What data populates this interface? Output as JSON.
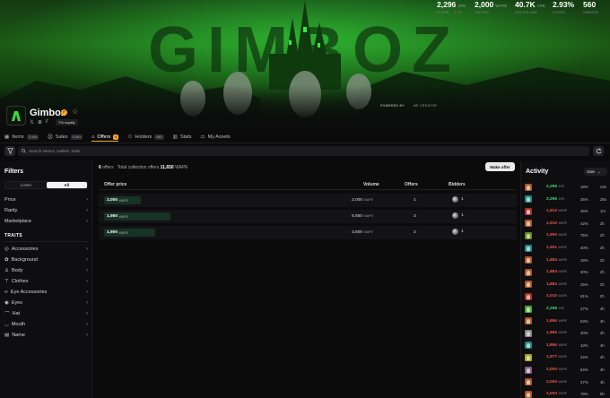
{
  "collection": {
    "name": "Gimboz",
    "royalty": "7% royalty",
    "banner_text": "GIMBOZ",
    "powered_by": "POWERED BY",
    "powered_by_name": "ME CREATOR"
  },
  "stats": [
    {
      "value": "2,296",
      "unit": "APE",
      "label": "FLOOR",
      "change": "-0.1%"
    },
    {
      "value": "2,000",
      "unit": "WAPE",
      "label": "TOP BID",
      "change": ""
    },
    {
      "value": "40.7K",
      "unit": "APE",
      "label": "24H VOLUME",
      "change": ""
    },
    {
      "value": "2.93%",
      "unit": "",
      "label": "LISTED",
      "change": ""
    },
    {
      "value": "560",
      "unit": "",
      "label": "OWNERS",
      "change": ""
    }
  ],
  "tabs": [
    {
      "label": "Items",
      "count": "3,444"
    },
    {
      "label": "Sales",
      "count": "4,491"
    },
    {
      "label": "Offers",
      "count": "6"
    },
    {
      "label": "Holders",
      "count": "560"
    },
    {
      "label": "Stats",
      "count": ""
    },
    {
      "label": "My Assets",
      "count": ""
    }
  ],
  "search": {
    "placeholder": "Search tokens, wallets, traits"
  },
  "filters": {
    "title": "Filters",
    "toggle": [
      "Listed",
      "All"
    ],
    "sections": [
      "Price",
      "Rarity",
      "Marketplace"
    ],
    "traits_title": "TRAITS",
    "traits": [
      "Accessories",
      "Background",
      "Body",
      "Clothes",
      "Eye Accessories",
      "Eyes",
      "Hat",
      "Mouth",
      "Name"
    ]
  },
  "offers": {
    "count": "6",
    "count_label": "offers",
    "total_label": "Total collection offers",
    "total_value": "11,650",
    "total_unit": "WAPE",
    "make_offer": "Make offer",
    "headers": [
      "Offer price",
      "Volume",
      "Offers",
      "Bidders"
    ],
    "rows": [
      {
        "price": "2,000",
        "unit": "WAPE",
        "volume": "2,000",
        "offers": "1",
        "bidders": "1",
        "fill": 0.17
      },
      {
        "price": "1,950",
        "unit": "WAPE",
        "volume": "5,850",
        "offers": "3",
        "bidders": "1",
        "fill": 0.5
      },
      {
        "price": "1,900",
        "unit": "WAPE",
        "volume": "3,800",
        "offers": "2",
        "bidders": "1",
        "fill": 0.33
      }
    ]
  },
  "activity": {
    "title": "Activity",
    "filter": "Sale",
    "rows": [
      {
        "price": "2,296",
        "unit": "APE",
        "pct": "19%",
        "time": "23s",
        "up": true,
        "thumb": "#b4552a"
      },
      {
        "price": "2,296",
        "unit": "APE",
        "pct": "25%",
        "time": "25s",
        "up": true,
        "thumb": "#1e8a8a"
      },
      {
        "price": "1,912",
        "unit": "WAPE",
        "pct": "45%",
        "time": "1m",
        "up": false,
        "thumb": "#b42a2a"
      },
      {
        "price": "1,910",
        "unit": "WAPE",
        "pct": "42%",
        "time": "2h",
        "up": false,
        "thumb": "#b4552a"
      },
      {
        "price": "1,900",
        "unit": "WAPE",
        "pct": "75%",
        "time": "2h",
        "up": false,
        "thumb": "#6a8a1e"
      },
      {
        "price": "1,901",
        "unit": "WAPE",
        "pct": "40%",
        "time": "2h",
        "up": false,
        "thumb": "#1e8a8a"
      },
      {
        "price": "1,884",
        "unit": "WAPE",
        "pct": "19%",
        "time": "2h",
        "up": false,
        "thumb": "#b4552a"
      },
      {
        "price": "1,884",
        "unit": "WAPE",
        "pct": "30%",
        "time": "2h",
        "up": false,
        "thumb": "#b4552a"
      },
      {
        "price": "1,884",
        "unit": "WAPE",
        "pct": "25%",
        "time": "2h",
        "up": false,
        "thumb": "#b4552a"
      },
      {
        "price": "2,010",
        "unit": "WAPE",
        "pct": "61%",
        "time": "2h",
        "up": false,
        "thumb": "#b42a2a"
      },
      {
        "price": "2,298",
        "unit": "APE",
        "pct": "27%",
        "time": "4h",
        "up": true,
        "thumb": "#4aa83a"
      },
      {
        "price": "1,866",
        "unit": "WAPE",
        "pct": "63%",
        "time": "4h",
        "up": false,
        "thumb": "#b4552a"
      },
      {
        "price": "1,866",
        "unit": "WAPE",
        "pct": "40%",
        "time": "4h",
        "up": false,
        "thumb": "#8a8a8a"
      },
      {
        "price": "1,866",
        "unit": "WAPE",
        "pct": "43%",
        "time": "4h",
        "up": false,
        "thumb": "#1e8a8a"
      },
      {
        "price": "1,977",
        "unit": "WAPE",
        "pct": "34%",
        "time": "4h",
        "up": false,
        "thumb": "#a8a81e"
      },
      {
        "price": "2,000",
        "unit": "WAPE",
        "pct": "64%",
        "time": "4h",
        "up": false,
        "thumb": "#8a5a8a"
      },
      {
        "price": "2,000",
        "unit": "WAPE",
        "pct": "27%",
        "time": "4h",
        "up": false,
        "thumb": "#b4552a"
      },
      {
        "price": "2,000",
        "unit": "WAPE",
        "pct": "78%",
        "time": "5h",
        "up": false,
        "thumb": "#b4552a"
      },
      {
        "price": "2,101",
        "unit": "WAPE",
        "pct": "17%",
        "time": "5h",
        "up": false,
        "thumb": "#6a6a6a"
      }
    ]
  },
  "colors": {
    "accent": "#f5a623",
    "positive": "#3ddc6a",
    "negative": "#ef5350",
    "banner": "#1c5a15"
  }
}
